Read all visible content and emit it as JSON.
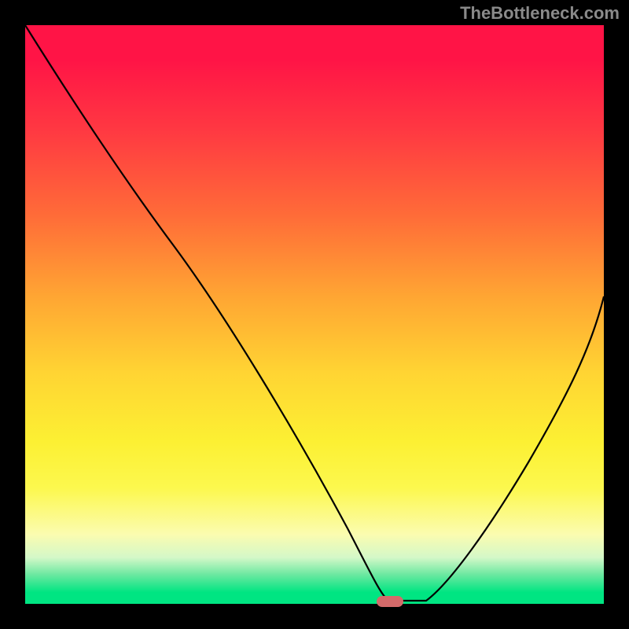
{
  "watermark": "TheBottleneck.com",
  "chart_data": {
    "type": "line",
    "title": "",
    "xlabel": "",
    "ylabel": "",
    "xlim": [
      0,
      100
    ],
    "ylim": [
      0,
      100
    ],
    "series": [
      {
        "name": "curve",
        "x": [
          0,
          20,
          40,
          55,
          60,
          64,
          70,
          80,
          90,
          100
        ],
        "y": [
          100,
          73,
          40,
          12,
          2,
          0,
          0,
          14,
          34,
          54
        ]
      }
    ],
    "marker": {
      "x": 63,
      "y": 0.4
    },
    "background_gradient": {
      "top": "#ff1446",
      "mid_upper": "#ff6c38",
      "mid": "#ffd433",
      "mid_lower": "#fcf84e",
      "bottom": "#00e582"
    }
  }
}
